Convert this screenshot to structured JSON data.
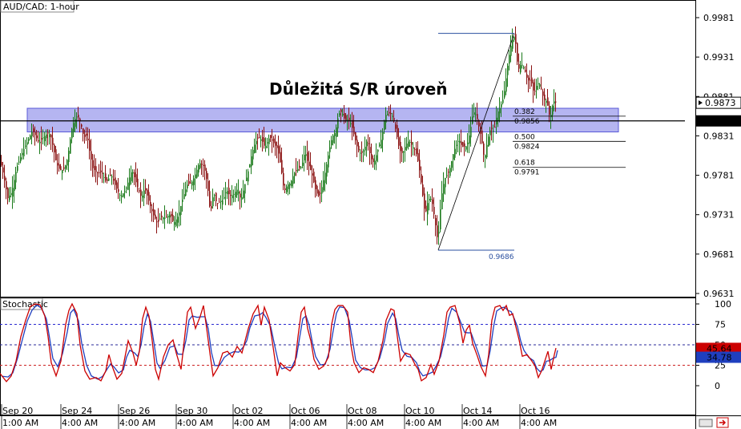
{
  "chart_data": [
    {
      "type": "candlestick",
      "title": "AUD/CAD: 1-hour",
      "annotation": "Důležitá S/R úroveň",
      "ylim": [
        0.9612,
        0.9998
      ],
      "y_ticks": [
        "0.9981",
        "0.9931",
        "0.9881",
        "0.9831",
        "0.9781",
        "0.9731",
        "0.9681",
        "0.9631"
      ],
      "last_price": "0.9873",
      "level_price": "0.9850",
      "sr_zone": [
        0.9836,
        0.9866
      ],
      "swing": {
        "low": 0.9686,
        "high": 0.9961,
        "low_label": "0.9686"
      },
      "fib_levels": [
        {
          "ratio": "0.382",
          "value": "0.9856"
        },
        {
          "ratio": "0.500",
          "value": "0.9824"
        },
        {
          "ratio": "0.618",
          "value": "0.9791"
        }
      ],
      "x_labels": [
        {
          "date": "Sep 20",
          "time": "1:00 AM"
        },
        {
          "date": "Sep 24",
          "time": "4:00 AM"
        },
        {
          "date": "Sep 26",
          "time": "4:00 AM"
        },
        {
          "date": "Sep 30",
          "time": "4:00 AM"
        },
        {
          "date": "Oct 02",
          "time": "4:00 AM"
        },
        {
          "date": "Oct 06",
          "time": "4:00 AM"
        },
        {
          "date": "Oct 08",
          "time": "4:00 AM"
        },
        {
          "date": "Oct 10",
          "time": "4:00 AM"
        },
        {
          "date": "Oct 14",
          "time": "4:00 AM"
        },
        {
          "date": "Oct 16",
          "time": "4:00 AM"
        }
      ],
      "price_path": [
        [
          0,
          0.9798
        ],
        [
          4,
          0.978
        ],
        [
          9,
          0.9752
        ],
        [
          14,
          0.976
        ],
        [
          20,
          0.979
        ],
        [
          28,
          0.9812
        ],
        [
          34,
          0.9825
        ],
        [
          40,
          0.9838
        ],
        [
          44,
          0.983
        ],
        [
          48,
          0.9822
        ],
        [
          52,
          0.9828
        ],
        [
          56,
          0.9832
        ],
        [
          60,
          0.9835
        ],
        [
          63,
          0.9829
        ],
        [
          66,
          0.9815
        ],
        [
          69,
          0.98
        ],
        [
          72,
          0.979
        ],
        [
          76,
          0.9787
        ],
        [
          80,
          0.979
        ],
        [
          84,
          0.9804
        ],
        [
          86,
          0.982
        ],
        [
          89,
          0.984
        ],
        [
          92,
          0.9851
        ],
        [
          96,
          0.9857
        ],
        [
          100,
          0.9847
        ],
        [
          104,
          0.9829
        ],
        [
          108,
          0.9832
        ],
        [
          111,
          0.9812
        ],
        [
          115,
          0.979
        ],
        [
          120,
          0.9784
        ],
        [
          126,
          0.9785
        ],
        [
          132,
          0.9772
        ],
        [
          138,
          0.9782
        ],
        [
          144,
          0.9766
        ],
        [
          150,
          0.9754
        ],
        [
          156,
          0.9762
        ],
        [
          164,
          0.9788
        ],
        [
          170,
          0.9769
        ],
        [
          176,
          0.9752
        ],
        [
          180,
          0.9765
        ],
        [
          184,
          0.9752
        ],
        [
          190,
          0.9732
        ],
        [
          196,
          0.972
        ],
        [
          200,
          0.9728
        ],
        [
          206,
          0.9727
        ],
        [
          212,
          0.9732
        ],
        [
          216,
          0.972
        ],
        [
          222,
          0.973
        ],
        [
          228,
          0.9754
        ],
        [
          233,
          0.9769
        ],
        [
          238,
          0.9771
        ],
        [
          242,
          0.9779
        ],
        [
          248,
          0.9797
        ],
        [
          254,
          0.9792
        ],
        [
          258,
          0.9771
        ],
        [
          262,
          0.9732
        ],
        [
          266,
          0.976
        ],
        [
          270,
          0.9744
        ],
        [
          274,
          0.9748
        ],
        [
          278,
          0.975
        ],
        [
          282,
          0.9763
        ],
        [
          286,
          0.9755
        ],
        [
          290,
          0.9756
        ],
        [
          296,
          0.9764
        ],
        [
          300,
          0.9749
        ],
        [
          306,
          0.9774
        ],
        [
          310,
          0.979
        ],
        [
          314,
          0.981
        ],
        [
          318,
          0.9823
        ],
        [
          322,
          0.9829
        ],
        [
          326,
          0.9826
        ],
        [
          330,
          0.9816
        ],
        [
          336,
          0.983
        ],
        [
          342,
          0.982
        ],
        [
          346,
          0.9814
        ],
        [
          350,
          0.9792
        ],
        [
          354,
          0.976
        ],
        [
          358,
          0.9769
        ],
        [
          362,
          0.9771
        ],
        [
          366,
          0.9783
        ],
        [
          372,
          0.979
        ],
        [
          376,
          0.9792
        ],
        [
          380,
          0.9812
        ],
        [
          384,
          0.9795
        ],
        [
          388,
          0.9785
        ],
        [
          394,
          0.9759
        ],
        [
          398,
          0.9754
        ],
        [
          402,
          0.977
        ],
        [
          406,
          0.9789
        ],
        [
          410,
          0.9812
        ],
        [
          414,
          0.983
        ],
        [
          418,
          0.9836
        ],
        [
          422,
          0.9859
        ],
        [
          426,
          0.9862
        ],
        [
          430,
          0.985
        ],
        [
          434,
          0.9852
        ],
        [
          438,
          0.9845
        ],
        [
          442,
          0.9829
        ],
        [
          446,
          0.9814
        ],
        [
          450,
          0.9808
        ],
        [
          454,
          0.9814
        ],
        [
          458,
          0.9827
        ],
        [
          462,
          0.9803
        ],
        [
          466,
          0.9796
        ],
        [
          472,
          0.9817
        ],
        [
          476,
          0.9829
        ],
        [
          480,
          0.9857
        ],
        [
          486,
          0.986
        ],
        [
          490,
          0.9855
        ],
        [
          494,
          0.9835
        ],
        [
          498,
          0.9813
        ],
        [
          502,
          0.9808
        ],
        [
          506,
          0.982
        ],
        [
          510,
          0.9825
        ],
        [
          514,
          0.9818
        ],
        [
          518,
          0.9812
        ],
        [
          522,
          0.9795
        ],
        [
          526,
          0.9764
        ],
        [
          530,
          0.973
        ],
        [
          534,
          0.9751
        ],
        [
          538,
          0.9751
        ],
        [
          542,
          0.9725
        ],
        [
          546,
          0.9695
        ],
        [
          550,
          0.9752
        ],
        [
          554,
          0.9776
        ],
        [
          560,
          0.9786
        ],
        [
          566,
          0.9812
        ],
        [
          572,
          0.9827
        ],
        [
          576,
          0.9817
        ],
        [
          582,
          0.9818
        ],
        [
          586,
          0.9836
        ],
        [
          590,
          0.9862
        ],
        [
          594,
          0.9857
        ],
        [
          600,
          0.9829
        ],
        [
          604,
          0.98
        ],
        [
          608,
          0.9826
        ],
        [
          612,
          0.9842
        ],
        [
          616,
          0.9836
        ],
        [
          620,
          0.986
        ],
        [
          624,
          0.9868
        ],
        [
          628,
          0.988
        ],
        [
          634,
          0.9928
        ],
        [
          638,
          0.9951
        ],
        [
          642,
          0.9959
        ],
        [
          646,
          0.9914
        ],
        [
          650,
          0.9923
        ],
        [
          654,
          0.9916
        ],
        [
          658,
          0.9901
        ],
        [
          662,
          0.9902
        ],
        [
          666,
          0.9884
        ],
        [
          670,
          0.9898
        ],
        [
          674,
          0.9896
        ],
        [
          678,
          0.9877
        ],
        [
          682,
          0.9875
        ],
        [
          686,
          0.9852
        ],
        [
          690,
          0.9875
        ],
        [
          694,
          0.9874
        ]
      ]
    },
    {
      "type": "line",
      "title": "Stochastic",
      "ylim": [
        0,
        100
      ],
      "y_ticks": [
        "100",
        "75",
        "50",
        "25",
        "0"
      ],
      "levels": [
        75,
        50,
        25
      ],
      "series": [
        {
          "value": "45.64",
          "color": "#cc0000"
        },
        {
          "value": "34.78",
          "color": "#1f3fbf"
        }
      ],
      "k_path": [
        [
          0,
          15
        ],
        [
          8,
          5
        ],
        [
          14,
          12
        ],
        [
          20,
          30
        ],
        [
          26,
          60
        ],
        [
          32,
          80
        ],
        [
          38,
          97
        ],
        [
          44,
          100
        ],
        [
          50,
          99
        ],
        [
          56,
          85
        ],
        [
          60,
          60
        ],
        [
          64,
          28
        ],
        [
          70,
          12
        ],
        [
          76,
          30
        ],
        [
          82,
          75
        ],
        [
          86,
          92
        ],
        [
          90,
          100
        ],
        [
          96,
          88
        ],
        [
          100,
          50
        ],
        [
          106,
          18
        ],
        [
          112,
          8
        ],
        [
          120,
          10
        ],
        [
          126,
          6
        ],
        [
          132,
          18
        ],
        [
          136,
          38
        ],
        [
          140,
          24
        ],
        [
          146,
          8
        ],
        [
          152,
          15
        ],
        [
          156,
          35
        ],
        [
          160,
          55
        ],
        [
          166,
          40
        ],
        [
          170,
          25
        ],
        [
          174,
          42
        ],
        [
          178,
          82
        ],
        [
          182,
          96
        ],
        [
          186,
          85
        ],
        [
          190,
          55
        ],
        [
          194,
          20
        ],
        [
          198,
          8
        ],
        [
          204,
          35
        ],
        [
          210,
          50
        ],
        [
          216,
          56
        ],
        [
          220,
          40
        ],
        [
          226,
          20
        ],
        [
          230,
          55
        ],
        [
          234,
          90
        ],
        [
          238,
          96
        ],
        [
          244,
          70
        ],
        [
          250,
          85
        ],
        [
          254,
          98
        ],
        [
          258,
          70
        ],
        [
          262,
          40
        ],
        [
          266,
          12
        ],
        [
          272,
          22
        ],
        [
          278,
          40
        ],
        [
          284,
          42
        ],
        [
          290,
          35
        ],
        [
          296,
          48
        ],
        [
          302,
          40
        ],
        [
          306,
          55
        ],
        [
          310,
          70
        ],
        [
          316,
          88
        ],
        [
          322,
          98
        ],
        [
          326,
          74
        ],
        [
          330,
          96
        ],
        [
          336,
          80
        ],
        [
          342,
          40
        ],
        [
          346,
          12
        ],
        [
          350,
          28
        ],
        [
          356,
          22
        ],
        [
          362,
          18
        ],
        [
          368,
          26
        ],
        [
          372,
          60
        ],
        [
          376,
          90
        ],
        [
          380,
          96
        ],
        [
          384,
          70
        ],
        [
          388,
          55
        ],
        [
          392,
          32
        ],
        [
          398,
          20
        ],
        [
          404,
          24
        ],
        [
          410,
          35
        ],
        [
          414,
          75
        ],
        [
          418,
          93
        ],
        [
          422,
          98
        ],
        [
          428,
          98
        ],
        [
          434,
          90
        ],
        [
          438,
          50
        ],
        [
          442,
          28
        ],
        [
          448,
          16
        ],
        [
          454,
          22
        ],
        [
          460,
          20
        ],
        [
          466,
          16
        ],
        [
          472,
          30
        ],
        [
          478,
          55
        ],
        [
          482,
          80
        ],
        [
          488,
          94
        ],
        [
          492,
          92
        ],
        [
          496,
          60
        ],
        [
          500,
          30
        ],
        [
          506,
          40
        ],
        [
          512,
          38
        ],
        [
          518,
          26
        ],
        [
          522,
          20
        ],
        [
          526,
          6
        ],
        [
          532,
          10
        ],
        [
          538,
          26
        ],
        [
          542,
          14
        ],
        [
          548,
          30
        ],
        [
          554,
          62
        ],
        [
          558,
          90
        ],
        [
          562,
          96
        ],
        [
          568,
          98
        ],
        [
          574,
          76
        ],
        [
          578,
          52
        ],
        [
          582,
          68
        ],
        [
          586,
          74
        ],
        [
          590,
          52
        ],
        [
          596,
          36
        ],
        [
          600,
          24
        ],
        [
          606,
          12
        ],
        [
          610,
          38
        ],
        [
          614,
          80
        ],
        [
          618,
          96
        ],
        [
          624,
          98
        ],
        [
          628,
          92
        ],
        [
          632,
          98
        ],
        [
          636,
          86
        ],
        [
          640,
          88
        ],
        [
          644,
          72
        ],
        [
          648,
          56
        ],
        [
          652,
          36
        ],
        [
          658,
          38
        ],
        [
          664,
          30
        ],
        [
          668,
          24
        ],
        [
          672,
          10
        ],
        [
          676,
          18
        ],
        [
          680,
          30
        ],
        [
          684,
          42
        ],
        [
          688,
          20
        ],
        [
          692,
          38
        ],
        [
          694,
          46
        ]
      ]
    }
  ]
}
